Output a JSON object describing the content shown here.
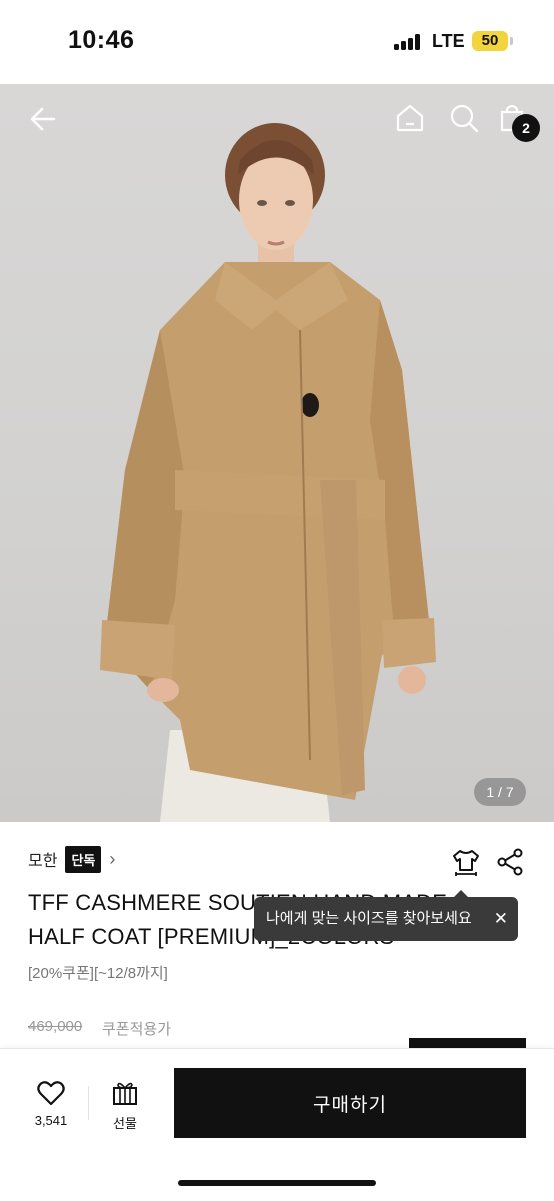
{
  "status_bar": {
    "time": "10:46",
    "network": "LTE",
    "battery": "50"
  },
  "header": {
    "cart_count": "2"
  },
  "gallery": {
    "counter": "1 / 7"
  },
  "product": {
    "brand": "모한",
    "exclusive_badge": "단독",
    "title_line1": "TFF CASHMERE SOUTIEN HAND MADE",
    "title_line2": "HALF COAT [PREMIUM]_2COLORS",
    "coupon_note": "[20%쿠폰][~12/8까지]",
    "original_price": "469,000",
    "coupon_price_label": "쿠폰적용가"
  },
  "size_tooltip": {
    "text": "나에게 맞는 사이즈를 찾아보세요",
    "close": "✕"
  },
  "bottom_bar": {
    "like_count": "3,541",
    "gift_label": "선물",
    "buy_label": "구매하기"
  },
  "colors": {
    "accent": "#111111",
    "coat": "#c49e6c",
    "battery": "#f2d53c",
    "tooltip_bg": "#3a3a3a"
  }
}
